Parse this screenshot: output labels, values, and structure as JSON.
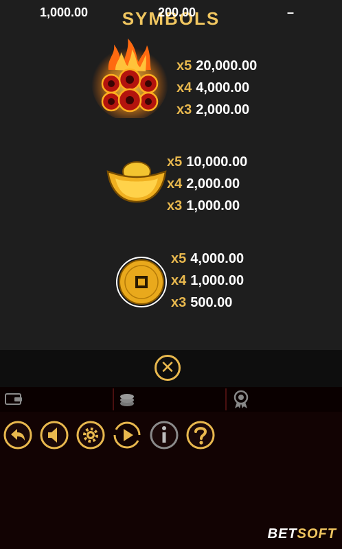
{
  "title": "SYMBOLS",
  "symbols": [
    {
      "name": "888",
      "pays": [
        {
          "mult": "x5",
          "amount": "20,000.00"
        },
        {
          "mult": "x4",
          "amount": "4,000.00"
        },
        {
          "mult": "x3",
          "amount": "2,000.00"
        }
      ]
    },
    {
      "name": "gold ingot",
      "pays": [
        {
          "mult": "x5",
          "amount": "10,000.00"
        },
        {
          "mult": "x4",
          "amount": "2,000.00"
        },
        {
          "mult": "x3",
          "amount": "1,000.00"
        }
      ]
    },
    {
      "name": "gold coin",
      "pays": [
        {
          "mult": "x5",
          "amount": "4,000.00"
        },
        {
          "mult": "x4",
          "amount": "1,000.00"
        },
        {
          "mult": "x3",
          "amount": "500.00"
        }
      ]
    }
  ],
  "close_icon": "close-icon",
  "status": {
    "balance": "1,000.00",
    "bet": "200.00",
    "win": "–"
  },
  "controls": [
    "back-icon",
    "sound-icon",
    "settings-icon",
    "autoplay-icon",
    "info-icon",
    "help-icon"
  ],
  "logo": {
    "part1": "BET",
    "part2": "SOFT"
  },
  "colors": {
    "gold": "#e8b84e",
    "background": "#1e1e1e",
    "bar": "#120303"
  }
}
